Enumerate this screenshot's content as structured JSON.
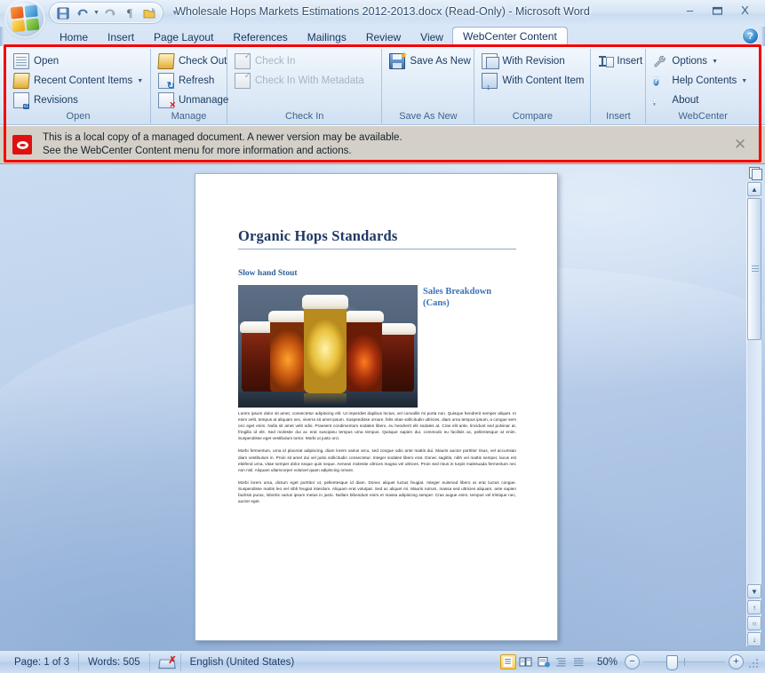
{
  "window": {
    "title": "Wholesale Hops Markets Estimations 2012-2013.docx (Read-Only)  -  Microsoft Word",
    "minimize_label": "–",
    "maximize_label": "❐",
    "close_label": "X"
  },
  "quick_access": {
    "items": [
      {
        "name": "office-orb",
        "label": "Office Button"
      },
      {
        "name": "save-icon",
        "label": "Save"
      },
      {
        "name": "undo-icon",
        "label": "Undo"
      },
      {
        "name": "redo-icon",
        "label": "Redo"
      },
      {
        "name": "pilcrow-icon",
        "label": "¶"
      },
      {
        "name": "folder-icon",
        "label": "Open Folder"
      }
    ],
    "customize_label": "▾"
  },
  "tabs": [
    {
      "label": "Home",
      "active": false
    },
    {
      "label": "Insert",
      "active": false
    },
    {
      "label": "Page Layout",
      "active": false
    },
    {
      "label": "References",
      "active": false
    },
    {
      "label": "Mailings",
      "active": false
    },
    {
      "label": "Review",
      "active": false
    },
    {
      "label": "View",
      "active": false
    },
    {
      "label": "WebCenter Content",
      "active": true
    }
  ],
  "help_button": "?",
  "ribbon": {
    "groups": [
      {
        "label": "Open",
        "items": [
          {
            "label": "Open",
            "icon": "document-icon",
            "dropdown": false,
            "disabled": false
          },
          {
            "label": "Recent Content Items",
            "icon": "folder-open-icon",
            "dropdown": true,
            "disabled": false
          },
          {
            "label": "Revisions",
            "icon": "revisions-icon",
            "dropdown": false,
            "disabled": false
          }
        ]
      },
      {
        "label": "Manage",
        "items": [
          {
            "label": "Check Out",
            "icon": "folder-open-icon",
            "dropdown": false,
            "disabled": false
          },
          {
            "label": "Refresh",
            "icon": "refresh-icon",
            "dropdown": false,
            "disabled": false
          },
          {
            "label": "Unmanage",
            "icon": "unmanage-icon",
            "dropdown": false,
            "disabled": false
          }
        ]
      },
      {
        "label": "Check In",
        "items": [
          {
            "label": "Check In",
            "icon": "checkin-icon",
            "dropdown": false,
            "disabled": true
          },
          {
            "label": "Check In With Metadata",
            "icon": "checkin-metadata-icon",
            "dropdown": false,
            "disabled": true
          }
        ]
      },
      {
        "label": "Save As New",
        "items": [
          {
            "label": "Save As New",
            "icon": "save-as-new-icon",
            "dropdown": false,
            "disabled": false
          }
        ]
      },
      {
        "label": "Compare",
        "items": [
          {
            "label": "With Revision",
            "icon": "compare-revision-icon",
            "dropdown": false,
            "disabled": false
          },
          {
            "label": "With Content Item",
            "icon": "compare-content-icon",
            "dropdown": false,
            "disabled": false
          }
        ]
      },
      {
        "label": "Insert",
        "items": [
          {
            "label": "Insert",
            "icon": "insert-icon",
            "dropdown": false,
            "disabled": false
          }
        ]
      },
      {
        "label": "WebCenter",
        "items": [
          {
            "label": "Options",
            "icon": "wrench-icon",
            "dropdown": true,
            "disabled": false
          },
          {
            "label": "Help Contents",
            "icon": "help-circle-icon",
            "dropdown": true,
            "disabled": false
          },
          {
            "label": "About",
            "icon": "info-circle-icon",
            "dropdown": false,
            "disabled": false
          }
        ]
      }
    ]
  },
  "info_bar": {
    "icon": "oracle-webcenter-icon",
    "line1": "This is a local copy of a managed document. A newer version may be available.",
    "line2": "See the WebCenter Content menu for more information and actions.",
    "close_label": "✕"
  },
  "document": {
    "heading": "Organic Hops Standards",
    "subheading": "Slow hand Stout",
    "image_alt": "five-beer-glasses-photo",
    "section_heading_part1": "Sales Breakdown",
    "section_heading_part2": "(Cans)",
    "paragraphs": [
      "Lorem ipsum dolor sit amet, consectetur adipiscing elit. Ut imperdiet dapibus lectus, vel convallis mi porta non. Quisque hendrerit semper aliquet. In enim velit, tempus at aliquam nec, viverra sit amet ipsum. Suspendisse ornare, felis vitae sollicitudin ultricies, diam urna tempus ipsum, a congue sem orci eget enim. Nulla sit amet velit odio. Praesent condimentum sodales libero, eu hendrerit elit sodales at. Cras elit ante, tincidunt sed pulvinar at, fringilla id elit. Sed molestie dui ac erat suscipieu tempus urna tempus. Quisque sapien dui, commodo eu facilisis ac, pellentesque at enim. Suspendisse eget vestibulum tortor. Morbi ut justo orci.",
      "Morbi fermentum, urna id placerat adipiscing, diam lorem varius arcu, sed congue odio ante mattis dui. Mauris auctor porttitor risus, vel accumsan diam vestibulum in. Proin sit amet dui vel justo sollicitudin consectetur. Integer sodales libero erat. Donec sagittis, nibh vel mattis semper, lacus est eleifend urna, vitae semper dolor neque quis neque. Aenean molestie ultrices magna vel ultrices. Proin sed risus in turpis malesuada fermentum nec non nisl. Aliquam ullamcorper volutvel quam adipiscing ornare.",
      "Morbi lorem urna, dictum eget porttitor ut, pellentesque id diam. Donec aliquet luctus feugiat. Integer euismod libero at erat luctus congue. Suspendisse mattis leo vel nibh feugiat interdum. Aliquam erat volutpat. Sed ac aliquet mi. Mauris rutrum, massa sed ultricies aliquam, ante sapien facilisis purus, lobortis varius ipsum metus in justo. Nullam bibendum enim et massa adipiscing semper. Cras augue enim, tempus vel tristique nec, auctor eget."
    ]
  },
  "status_bar": {
    "page": "Page: 1 of 3",
    "words": "Words: 505",
    "spell_icon": "spelling-check-icon",
    "language": "English (United States)",
    "view_buttons": [
      {
        "name": "print-layout-view",
        "active": true
      },
      {
        "name": "full-screen-reading-view",
        "active": false
      },
      {
        "name": "web-layout-view",
        "active": false
      },
      {
        "name": "outline-view",
        "active": false
      },
      {
        "name": "draft-view",
        "active": false
      }
    ],
    "zoom": "50%",
    "zoom_out_label": "−",
    "zoom_in_label": "+"
  },
  "scrollbar": {
    "up_label": "▲",
    "down_label": "▼",
    "prev_page_label": "↑",
    "select_object_label": "○",
    "next_page_label": "↓"
  },
  "colors": {
    "highlight_box": "#f40000",
    "accent_blue": "#1f3864",
    "info_bar_bg": "#d4d0c8",
    "oracle_red": "#e01010"
  }
}
